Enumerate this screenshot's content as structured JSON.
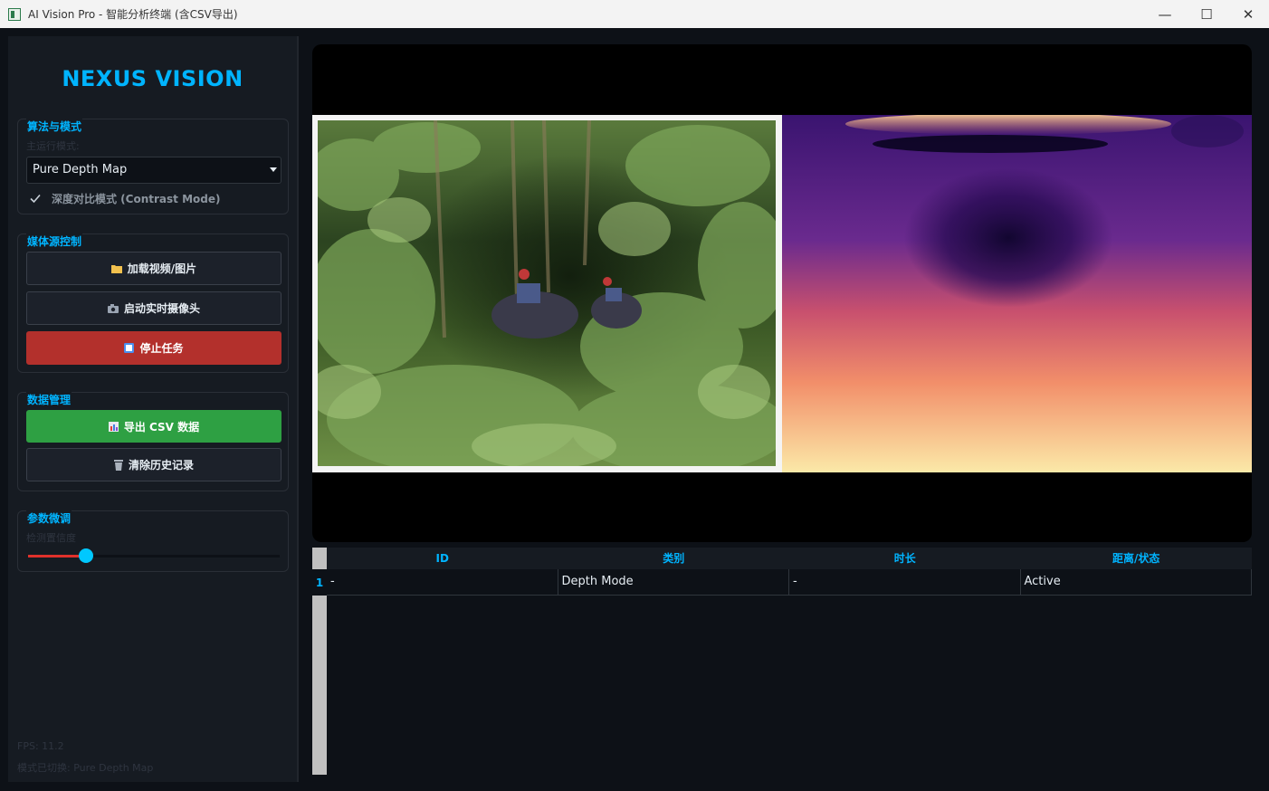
{
  "window": {
    "title": "AI Vision Pro - 智能分析终端 (含CSV导出)",
    "controls": [
      "—",
      "☐",
      "✕"
    ]
  },
  "sidebar": {
    "brand": "NEXUS VISION",
    "algorithm_group": {
      "title": "算法与模式",
      "hint": "主运行模式:",
      "mode_select": "Pure Depth Map",
      "contrast_checkbox": {
        "label": "深度对比模式 (Contrast Mode)",
        "checked": true
      }
    },
    "media_group": {
      "title": "媒体源控制",
      "load_button": "加载视频/图片",
      "camera_button": "启动实时摄像头",
      "stop_button": "停止任务"
    },
    "data_group": {
      "title": "数据管理",
      "export_button": "导出 CSV 数据",
      "clear_button": "清除历史记录"
    },
    "param_group": {
      "title": "参数微调",
      "hint": "检测置信度",
      "confidence_level": 0.23
    },
    "fps": "FPS: 11.2",
    "status": "模式已切换: Pure Depth Map"
  },
  "table": {
    "headers": [
      "ID",
      "类别",
      "时长",
      "距离/状态"
    ],
    "rows": [
      {
        "num": "1",
        "cells": [
          "-",
          "Depth Mode",
          "-",
          "Active"
        ]
      }
    ]
  },
  "colors": {
    "accent": "#00b4ff",
    "stop": "#b3302c",
    "export": "#2ea043",
    "background": "#0d1117"
  }
}
